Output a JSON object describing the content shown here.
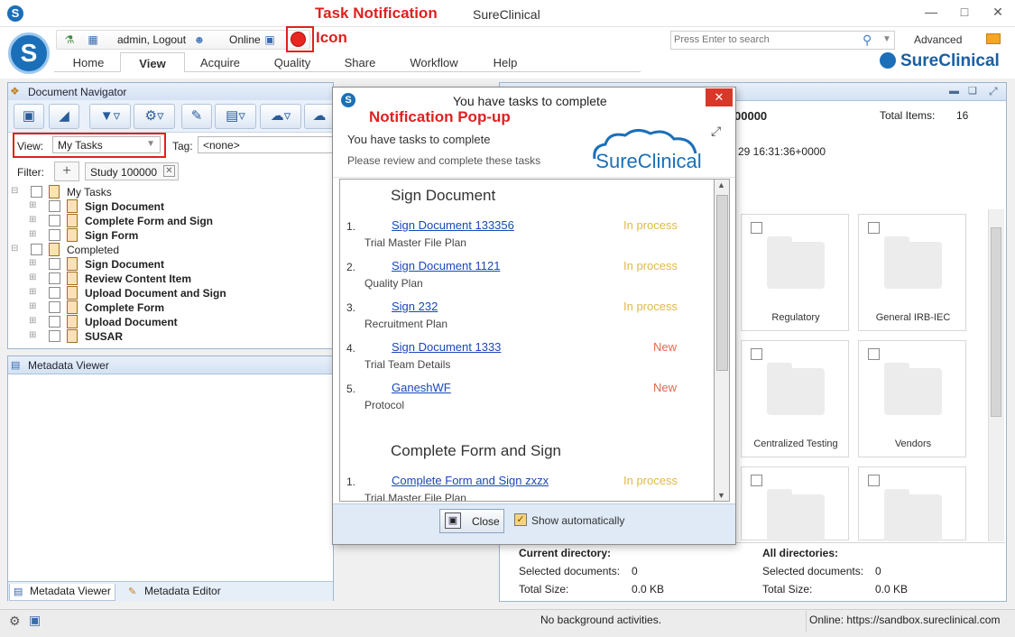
{
  "window": {
    "title": "SureClinical"
  },
  "annotations": {
    "task_notification": "Task Notification",
    "icon": "Icon",
    "popup": "Notification Pop-up"
  },
  "header": {
    "user": "admin, Logout",
    "status": "Online",
    "search_placeholder": "Press Enter to search",
    "advanced": "Advanced",
    "brand": "SureClinical",
    "tabs": [
      "Home",
      "View",
      "Acquire",
      "Quality",
      "Share",
      "Workflow",
      "Help"
    ],
    "active_tab": "View"
  },
  "doc_navigator": {
    "title": "Document Navigator",
    "view_label": "View:",
    "view_value": "My Tasks",
    "tag_label": "Tag:",
    "tag_value": "<none>",
    "filter_label": "Filter:",
    "filter_chip": "Study 100000",
    "tree": [
      {
        "label": "My Tasks",
        "level": 0,
        "bold": false
      },
      {
        "label": "Sign Document",
        "level": 1,
        "bold": true
      },
      {
        "label": "Complete Form and Sign",
        "level": 1,
        "bold": true
      },
      {
        "label": "Sign Form",
        "level": 1,
        "bold": true
      },
      {
        "label": "Completed",
        "level": 0,
        "bold": false
      },
      {
        "label": "Sign Document",
        "level": 1,
        "bold": true
      },
      {
        "label": "Review Content Item",
        "level": 1,
        "bold": true
      },
      {
        "label": "Upload Document and Sign",
        "level": 1,
        "bold": true
      },
      {
        "label": "Complete Form",
        "level": 1,
        "bold": true
      },
      {
        "label": "Upload Document",
        "level": 1,
        "bold": true
      },
      {
        "label": "SUSAR",
        "level": 1,
        "bold": true
      }
    ]
  },
  "metadata": {
    "title": "Metadata Viewer",
    "tabs": [
      "Metadata Viewer",
      "Metadata Editor"
    ]
  },
  "right_panel": {
    "id_fragment": "00000",
    "total_items_label": "Total Items:",
    "total_items": "16",
    "date_fragment": "29 16:31:36+0000",
    "folders": [
      "Regulatory",
      "General IRB-IEC",
      "Centralized Testing",
      "Vendors",
      "",
      ""
    ],
    "current_dir": {
      "title": "Current directory:",
      "selected_label": "Selected documents:",
      "selected": "0",
      "size_label": "Total Size:",
      "size": "0.0 KB"
    },
    "all_dirs": {
      "title": "All directories:",
      "selected_label": "Selected documents:",
      "selected": "0",
      "size_label": "Total Size:",
      "size": "0.0 KB"
    }
  },
  "statusbar": {
    "activity": "No background activities.",
    "online": "Online: https://sandbox.sureclinical.com"
  },
  "popup": {
    "title": "You have tasks to complete",
    "heading": "You have tasks to complete",
    "subheading": "Please review and complete these tasks",
    "brand": "SureClinical",
    "sections": [
      {
        "title": "Sign Document",
        "items": [
          {
            "num": "1.",
            "link": "Sign Document 133356",
            "status": "In process",
            "sub": "Trial Master File Plan"
          },
          {
            "num": "2.",
            "link": "Sign Document 1121",
            "status": "In process",
            "sub": "Quality Plan"
          },
          {
            "num": "3.",
            "link": "Sign 232",
            "status": "In process",
            "sub": "Recruitment Plan"
          },
          {
            "num": "4.",
            "link": "Sign Document 1333",
            "status": "New",
            "sub": "Trial Team Details"
          },
          {
            "num": "5.",
            "link": "GaneshWF",
            "status": "New",
            "sub": "Protocol"
          }
        ]
      },
      {
        "title": "Complete Form and Sign",
        "items": [
          {
            "num": "1.",
            "link": "Complete Form and Sign zxzx",
            "status": "In process",
            "sub": "Trial Master File Plan"
          }
        ]
      }
    ],
    "close_label": "Close",
    "show_auto_label": "Show automatically",
    "colors": {
      "in_process": "#e0b84a",
      "new": "#e06a50",
      "close_button": "#d9372a"
    }
  }
}
